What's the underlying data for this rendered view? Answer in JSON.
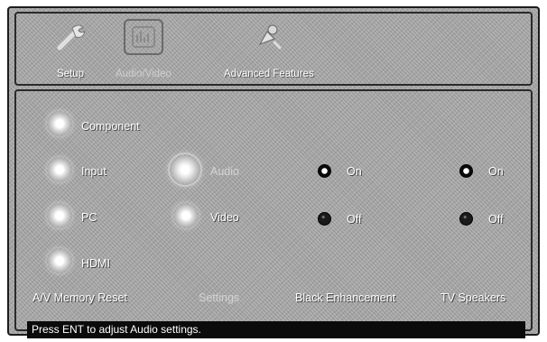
{
  "tabs": [
    {
      "label": "Setup",
      "icon": "wrench-icon"
    },
    {
      "label": "Audio/Video",
      "icon": "audio-video-icon"
    },
    {
      "label": "Advanced Features",
      "icon": "advanced-features-icon"
    }
  ],
  "inputs": {
    "component": "Component",
    "input": "Input",
    "pc": "PC",
    "hdmi": "HDMI"
  },
  "settings": {
    "audio": "Audio",
    "video": "Video"
  },
  "black_enhancement": {
    "on": "On",
    "off": "Off",
    "label": "Black Enhancement",
    "selected": "On"
  },
  "tv_speakers": {
    "on": "On",
    "off": "Off",
    "label": "TV Speakers",
    "selected": "On"
  },
  "bottom_labels": {
    "memory_reset": "A/V Memory Reset",
    "settings": "Settings"
  },
  "status_message": "Press ENT to adjust Audio settings."
}
